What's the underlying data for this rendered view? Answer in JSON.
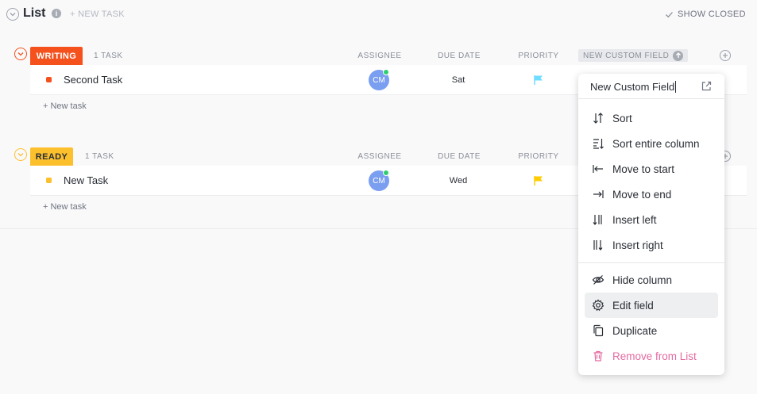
{
  "header": {
    "title": "List",
    "new_task": "+ NEW TASK",
    "show_closed": "SHOW CLOSED"
  },
  "columns": {
    "assignee": "ASSIGNEE",
    "due_date": "DUE DATE",
    "priority": "PRIORITY",
    "custom_field": "NEW CUSTOM FIELD"
  },
  "groups": [
    {
      "status": "WRITING",
      "color": "#f5511d",
      "count": "1 TASK",
      "tasks": [
        {
          "name": "Second Task",
          "assignee": "CM",
          "due": "Sat",
          "priority_color": "#6fddff"
        }
      ],
      "new_task": "+ New task"
    },
    {
      "status": "READY",
      "color": "#fcc02d",
      "count": "1 TASK",
      "tasks": [
        {
          "name": "New Task",
          "assignee": "CM",
          "due": "Wed",
          "priority_color": "#ffcc00"
        }
      ],
      "new_task": "+ New task"
    }
  ],
  "menu": {
    "field_name": "New Custom Field",
    "items": [
      {
        "label": "Sort",
        "icon": "sort-icon"
      },
      {
        "label": "Sort entire column",
        "icon": "sort-column-icon"
      },
      {
        "label": "Move to start",
        "icon": "move-start-icon"
      },
      {
        "label": "Move to end",
        "icon": "move-end-icon"
      },
      {
        "label": "Insert left",
        "icon": "insert-left-icon"
      },
      {
        "label": "Insert right",
        "icon": "insert-right-icon"
      },
      {
        "label": "Hide column",
        "icon": "eye-off-icon"
      },
      {
        "label": "Edit field",
        "icon": "gear-icon"
      },
      {
        "label": "Duplicate",
        "icon": "duplicate-icon"
      },
      {
        "label": "Remove from List",
        "icon": "trash-icon"
      }
    ]
  },
  "colors": {
    "accent_danger": "#e36aa1",
    "online": "#2ecd6f",
    "avatar": "#7b9ff0"
  }
}
